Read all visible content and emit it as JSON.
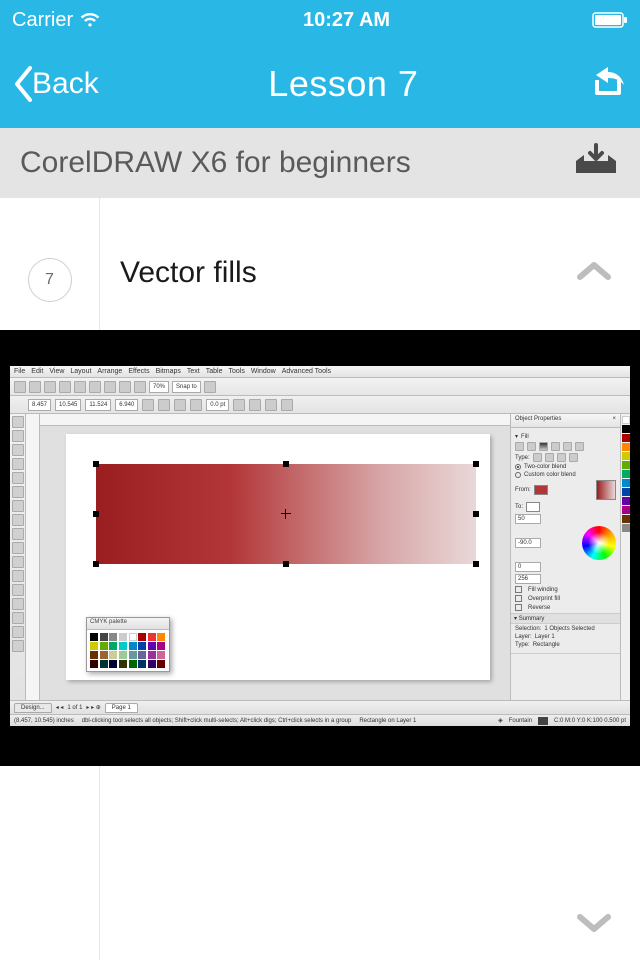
{
  "status": {
    "carrier": "Carrier",
    "time": "10:27 AM"
  },
  "nav": {
    "back_label": "Back",
    "title": "Lesson 7"
  },
  "course": {
    "title": "CorelDRAW X6 for beginners"
  },
  "lesson": {
    "number": "7",
    "title": "Vector fills"
  },
  "corel": {
    "menu": [
      "File",
      "Edit",
      "View",
      "Layout",
      "Arrange",
      "Effects",
      "Bitmaps",
      "Text",
      "Table",
      "Tools",
      "Window",
      "Advanced Tools"
    ],
    "zoom": "70%",
    "snap": "Snap to",
    "units": "0.0 pt",
    "coords": {
      "x": "8.457",
      "y": "10.545",
      "units": "inches",
      "w": "11.524",
      "h": "6.940"
    },
    "pager": {
      "page_count": "1 of 1",
      "page_tab": "Page 1"
    },
    "status_hint": "dbl-clicking tool selects all objects; Shift+click multi-selects; Alt+click digs; Ctrl+click selects in a group",
    "status_layer": "Rectangle on Layer 1",
    "task_tab": "Design...",
    "palette_title": "CMYK palette",
    "dock": {
      "title": "Object Properties",
      "section_fill": "Fill",
      "type_label": "Type:",
      "blend_two": "Two-color blend",
      "blend_custom": "Custom color blend",
      "from_label": "From:",
      "to_label": "To:",
      "midpoint": "50",
      "angle_label": "-90.0",
      "edge_pad": "0",
      "steps": "256",
      "opt_winding": "Fill winding",
      "opt_overprint": "Overprint fill",
      "opt_reverse": "Reverse",
      "summary_title": "Summary",
      "sel": "Selection:",
      "sel_val": "1 Objects Selected",
      "layer": "Layer:",
      "layer_val": "Layer 1",
      "type": "Type:",
      "type_val": "Rectangle",
      "footer_fill": "Fountain",
      "footer_outline": "C:0 M:0 Y:0 K:100 0.500 pt"
    }
  }
}
